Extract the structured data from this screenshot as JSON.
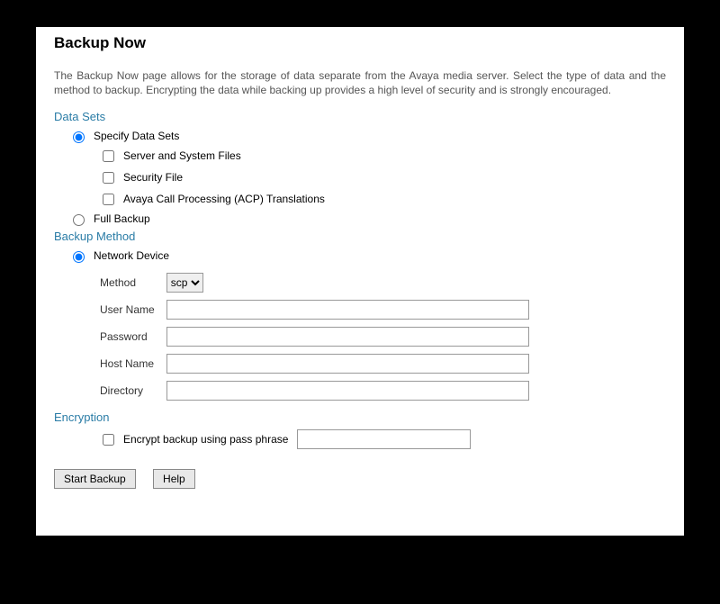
{
  "title": "Backup Now",
  "description": "The Backup Now page allows for the storage of data separate from the Avaya media server. Select the type of data and the method to backup. Encrypting the data while backing up provides a high level of security and is strongly encouraged.",
  "sections": {
    "dataSets": {
      "heading": "Data Sets",
      "specifyLabel": "Specify Data Sets",
      "options": {
        "serverSystem": "Server and System Files",
        "securityFile": "Security File",
        "acpTranslations": "Avaya Call Processing (ACP) Translations"
      },
      "fullBackupLabel": "Full Backup"
    },
    "backupMethod": {
      "heading": "Backup Method",
      "networkDeviceLabel": "Network Device",
      "fields": {
        "methodLabel": "Method",
        "methodSelected": "scp",
        "userNameLabel": "User Name",
        "passwordLabel": "Password",
        "hostNameLabel": "Host Name",
        "directoryLabel": "Directory"
      },
      "values": {
        "userName": "",
        "password": "",
        "hostName": "",
        "directory": ""
      }
    },
    "encryption": {
      "heading": "Encryption",
      "label": "Encrypt backup using pass phrase",
      "value": ""
    }
  },
  "buttons": {
    "startBackup": "Start Backup",
    "help": "Help"
  }
}
